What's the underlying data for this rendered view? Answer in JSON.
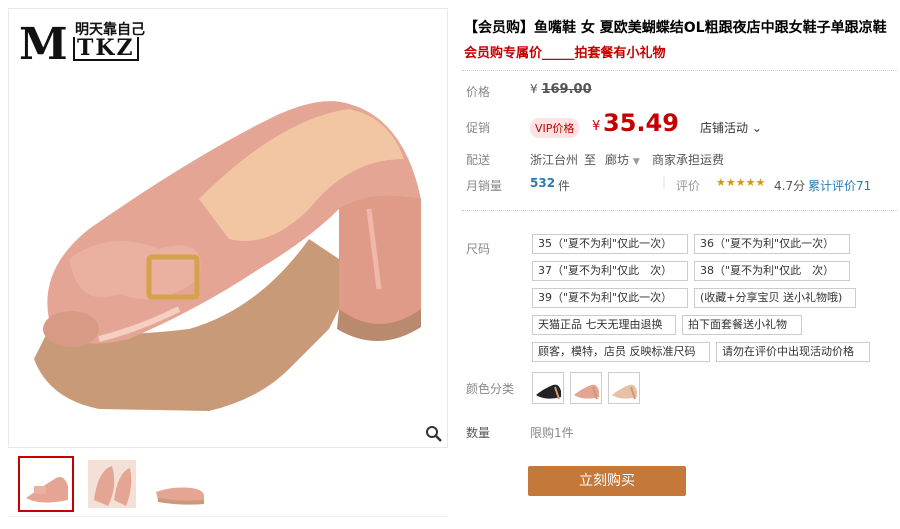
{
  "logo": {
    "big": "M",
    "sub": "TKZ",
    "cn": "明天靠自己"
  },
  "product": {
    "title": "【会员购】鱼嘴鞋 女 夏欧美蝴蝶结OL粗跟夜店中跟女鞋子单跟凉鞋",
    "subtitle": "会员购专属价_____拍套餐有小礼物"
  },
  "price": {
    "label": "价格",
    "currency": "¥",
    "original": "169.00"
  },
  "promo": {
    "label": "促销",
    "vip_tag": "VIP价格",
    "currency": "¥",
    "price": "35.49",
    "shop_activity": "店铺活动"
  },
  "delivery": {
    "label": "配送",
    "origin": "浙江台州",
    "to": "至",
    "dest": "廊坊",
    "carrier": "商家承担运费"
  },
  "sales": {
    "label": "月销量",
    "count": "532",
    "unit": "件",
    "rating_label": "评价",
    "stars": "★★★★★",
    "score": "4.7分",
    "cumulative": "累计评价71"
  },
  "size": {
    "label": "尺码",
    "options": [
      "35（\"夏不为利\"仅此一次）",
      "36（\"夏不为利\"仅此一次）",
      "37（\"夏不为利\"仅此　次）",
      "38（\"夏不为利\"仅此　次）",
      "39（\"夏不为利\"仅此一次）",
      "(收藏+分享宝贝 送小礼物哦)",
      "天猫正品 七天无理由退换",
      "拍下面套餐送小礼物",
      "顾客，模特，店员 反映标准尺码",
      "请勿在评价中出现活动价格"
    ]
  },
  "color": {
    "label": "颜色分类",
    "swatches": [
      "black-pump",
      "pink-pump",
      "nude-pump"
    ]
  },
  "quantity": {
    "label": "数量",
    "limit": "限购1件"
  },
  "buy_button": "立刻购买",
  "colors": {
    "accent": "#c40000",
    "buy": "#c4783a",
    "shoe": "#e4a595"
  }
}
